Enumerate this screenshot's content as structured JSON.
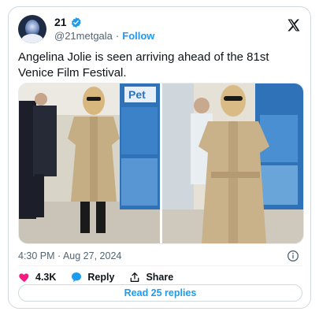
{
  "author": {
    "name": "21",
    "handle": "@21metgala",
    "separator": "·",
    "follow_label": "Follow"
  },
  "tweet": {
    "text": "Angelina Jolie is seen arriving ahead of the 81st Venice Film Festival.",
    "image_sign_text": "Pet",
    "timestamp": "4:30 PM · Aug 27, 2024"
  },
  "actions": {
    "like_count": "4.3K",
    "reply_label": "Reply",
    "share_label": "Share"
  },
  "read_replies_label": "Read 25 replies",
  "colors": {
    "accent": "#1d9bf0",
    "like": "#f91880",
    "text": "#0f1419",
    "secondary": "#536471"
  },
  "icons": [
    "verified-badge-icon",
    "x-logo-icon",
    "info-icon",
    "heart-icon",
    "reply-icon",
    "share-icon"
  ]
}
